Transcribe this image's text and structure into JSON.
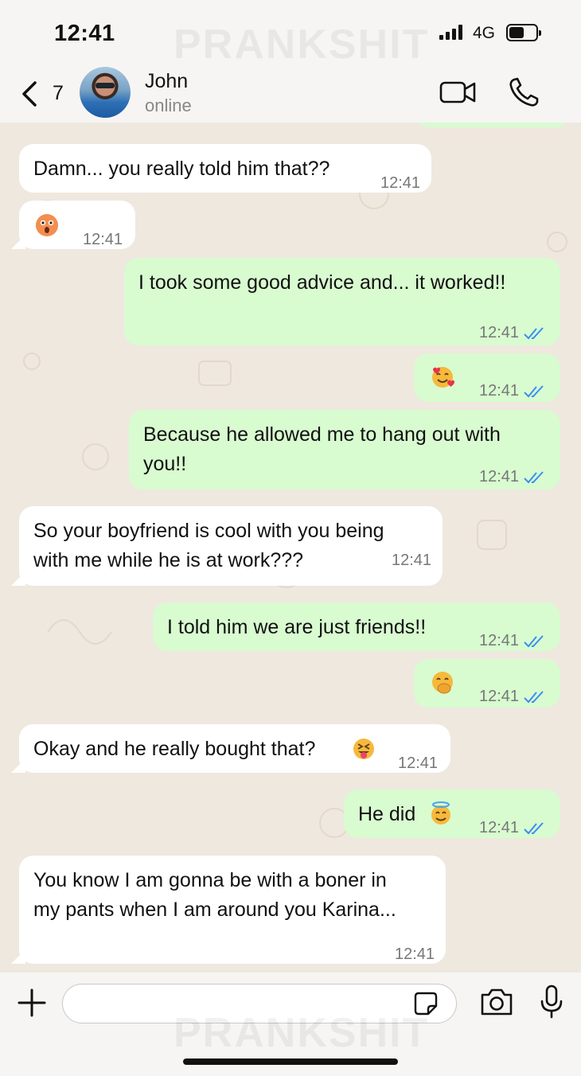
{
  "status_bar": {
    "time": "12:41",
    "network": "4G"
  },
  "watermark": "PRANKSHIT",
  "header": {
    "unread_count": "7",
    "contact_name": "John",
    "status": "online"
  },
  "messages": [
    {
      "side": "in",
      "text": "Damn... you really told him that??",
      "time": "12:41"
    },
    {
      "side": "in",
      "emoji": "astonished-face",
      "time": "12:41"
    },
    {
      "side": "out",
      "text": "I took some good advice and... it worked!!",
      "time": "12:41",
      "read": true
    },
    {
      "side": "out",
      "emoji": "smiling-face-with-hearts",
      "time": "12:41",
      "read": true
    },
    {
      "side": "out",
      "lines": [
        "Because he allowed me to hang out with",
        "you!!"
      ],
      "time": "12:41",
      "read": true
    },
    {
      "side": "in",
      "lines": [
        "So your boyfriend is cool with you being",
        "with me while he is at work???"
      ],
      "time": "12:41"
    },
    {
      "side": "out",
      "text": "I told him we are just friends!!",
      "time": "12:41",
      "read": true
    },
    {
      "side": "out",
      "emoji": "face-with-hand-over-mouth",
      "time": "12:41",
      "read": true
    },
    {
      "side": "in",
      "text": "Okay and he really bought that?",
      "emoji": "squinting-face-with-tongue",
      "time": "12:41"
    },
    {
      "side": "out",
      "text": "He did",
      "emoji": "smiling-face-with-halo",
      "time": "12:41",
      "read": true
    },
    {
      "side": "in",
      "lines": [
        "You know I am gonna be with a boner in",
        "my pants when I am around you Karina..."
      ],
      "time": "12:41"
    }
  ],
  "colors": {
    "incoming": "#ffffff",
    "outgoing": "#d8fbd0",
    "read_ticks": "#3b8df0",
    "wallpaper": "#efe8df"
  },
  "input": {
    "placeholder": "",
    "value": ""
  }
}
